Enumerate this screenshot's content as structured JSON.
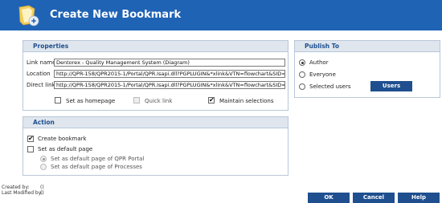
{
  "header": {
    "title": "Create New Bookmark"
  },
  "properties": {
    "title": "Properties",
    "link_name_label": "Link name",
    "link_name_value": "Dentorex - Quality Management System (Diagram)",
    "location_label": "Location",
    "location_value": "http://QPR-158/QPR2015-1/Portal/QPR.Isapi.dll?PGPLUGIN&*xlink&VTN=flowchart&SID=",
    "direct_link_label": "Direct link",
    "direct_link_value": "http://QPR-158/QPR2015-1/Portal/QPR.Isapi.dll?PGPLUGIN&*xlink&VTN=flowchart&SID=",
    "set_as_homepage_label": "Set as homepage",
    "set_as_homepage_checked": false,
    "quick_link_label": "Quick link",
    "quick_link_checked": false,
    "maintain_selections_label": "Maintain selections",
    "maintain_selections_checked": true
  },
  "publish": {
    "title": "Publish To",
    "options": [
      "Author",
      "Everyone",
      "Selected users"
    ],
    "selected": "Author",
    "users_button": "Users"
  },
  "action": {
    "title": "Action",
    "create_bookmark_label": "Create bookmark",
    "create_bookmark_checked": true,
    "set_default_page_label": "Set as default page",
    "set_default_page_checked": false,
    "default_options": [
      "Set as default page of QPR Portal",
      "Set as default page of Processes"
    ],
    "default_selected": "Set as default page of QPR Portal"
  },
  "footer": {
    "created_by_label": "Created by:",
    "created_by_value": "()",
    "last_modified_label": "Last Modified by:",
    "last_modified_value": "()"
  },
  "buttons": {
    "ok": "OK",
    "cancel": "Cancel",
    "help": "Help"
  },
  "colors": {
    "header": "#1f63b5",
    "button": "#1f4f8f",
    "panel_header": "#dfe6ee"
  }
}
